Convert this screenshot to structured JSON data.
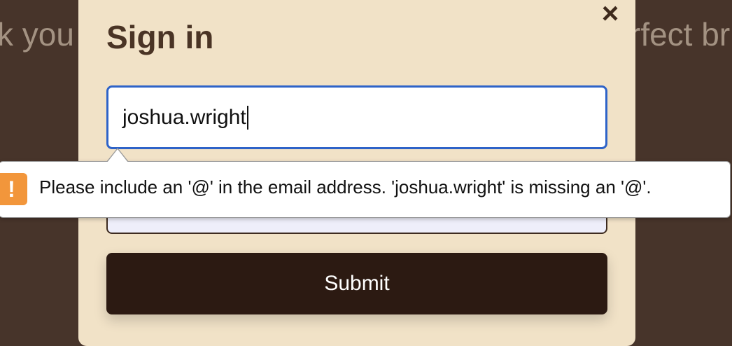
{
  "background": {
    "left_text": "k you",
    "right_text": "rfect br"
  },
  "modal": {
    "title": "Sign in",
    "close_icon": "×",
    "email_value": "joshua.wright",
    "password_value": "",
    "submit_label": "Submit"
  },
  "validation": {
    "icon": "!",
    "message": "Please include an '@' in the email address. 'joshua.wright' is missing an '@'."
  },
  "colors": {
    "page_bg": "#47342a",
    "modal_bg": "#f1e2c7",
    "focus_border": "#2e63c8",
    "submit_bg": "#2c1a12",
    "warning": "#f2963b"
  }
}
